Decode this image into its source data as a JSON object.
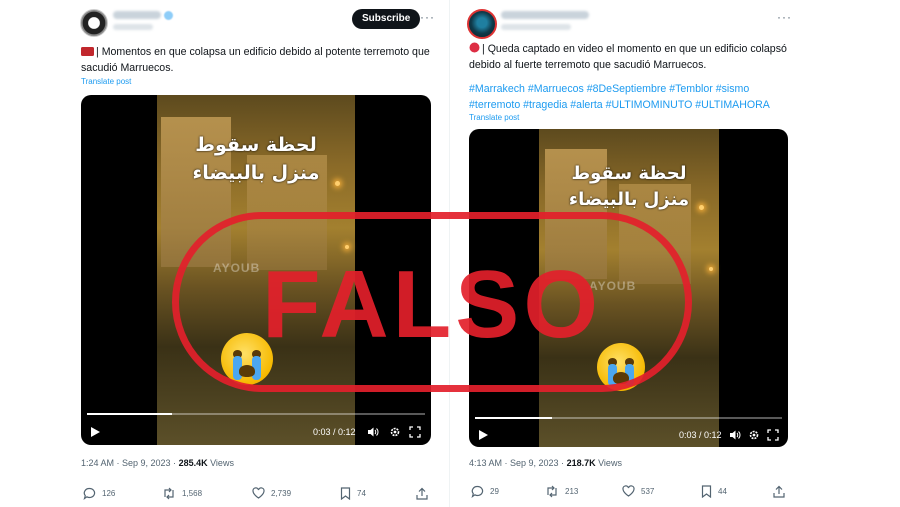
{
  "left_post": {
    "subscribe_label": "Subscribe",
    "more_label": "···",
    "text": "| Momentos en que colapsa un edificio debido al potente terremoto que sacudió Marruecos.",
    "translate": "Translate post",
    "video": {
      "overlay_text_line1": "لحظة سقوط",
      "overlay_text_line2": "منزل بالبيضاء",
      "watermark": "AYOUB",
      "time": "0:03 / 0:12",
      "progress": 0.25
    },
    "timestamp": "1:24 AM · Sep 9, 2023 · ",
    "views_count": "285.4K",
    "views_label": " Views",
    "actions": {
      "replies": "126",
      "reposts": "1,568",
      "likes": "2,739",
      "bookmarks": "74"
    }
  },
  "right_post": {
    "more_label": "···",
    "text": "| Queda captado en video el momento en que un edificio colapsó debido al fuerte terremoto que sacudió Marruecos.",
    "hashtags_line1": "#Marrakech #Marruecos #8DeSeptiembre #Temblor #sismo",
    "hashtags_line2": "#terremoto #tragedia #alerta #ULTIMOMINUTO #ULTIMAHORA",
    "translate": "Translate post",
    "video": {
      "overlay_text_line1": "لحظة سقوط",
      "overlay_text_line2": "منزل بالبيضاء",
      "watermark": "AYOUB",
      "time": "0:03 / 0:12",
      "progress": 0.25
    },
    "timestamp": "4:13 AM · Sep 9, 2023 · ",
    "views_count": "218.7K",
    "views_label": " Views",
    "actions": {
      "replies": "29",
      "reposts": "213",
      "likes": "537",
      "bookmarks": "44"
    }
  },
  "stamp": {
    "label": "FALSO",
    "color": "#e3202b"
  },
  "colors": {
    "link": "#1d9bf0",
    "muted": "#536471",
    "text": "#0f1419"
  }
}
